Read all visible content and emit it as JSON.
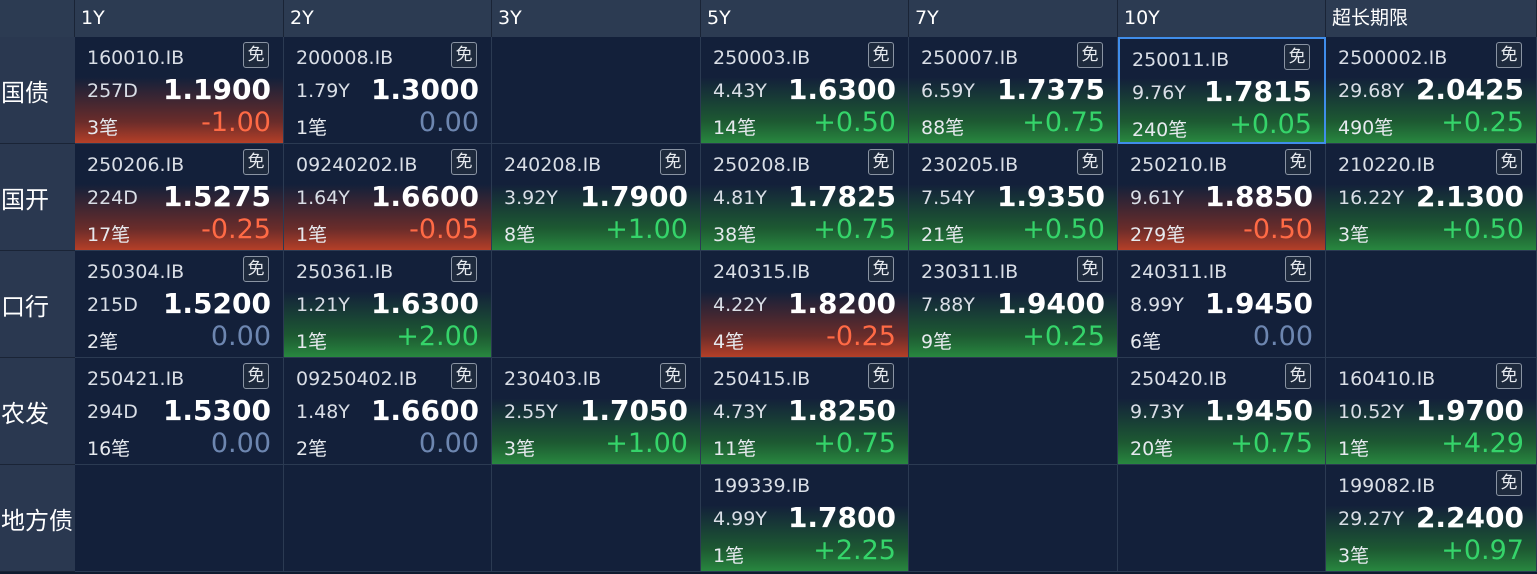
{
  "columns": [
    "1Y",
    "2Y",
    "3Y",
    "5Y",
    "7Y",
    "10Y",
    "超长期限"
  ],
  "rows": [
    {
      "label": "国债",
      "cells": [
        {
          "code": "160010.IB",
          "tenor": "257D",
          "yield": "1.1900",
          "trades": "3笔",
          "change": "-1.00",
          "dir": "down",
          "badge": "免"
        },
        {
          "code": "200008.IB",
          "tenor": "1.79Y",
          "yield": "1.3000",
          "trades": "1笔",
          "change": "0.00",
          "dir": "flat",
          "badge": "免"
        },
        null,
        {
          "code": "250003.IB",
          "tenor": "4.43Y",
          "yield": "1.6300",
          "trades": "14笔",
          "change": "+0.50",
          "dir": "up",
          "badge": "免"
        },
        {
          "code": "250007.IB",
          "tenor": "6.59Y",
          "yield": "1.7375",
          "trades": "88笔",
          "change": "+0.75",
          "dir": "up",
          "badge": "免"
        },
        {
          "code": "250011.IB",
          "tenor": "9.76Y",
          "yield": "1.7815",
          "trades": "240笔",
          "change": "+0.05",
          "dir": "up",
          "badge": "免",
          "selected": true
        },
        {
          "code": "2500002.IB",
          "tenor": "29.68Y",
          "yield": "2.0425",
          "trades": "490笔",
          "change": "+0.25",
          "dir": "up",
          "badge": "免"
        }
      ]
    },
    {
      "label": "国开",
      "cells": [
        {
          "code": "250206.IB",
          "tenor": "224D",
          "yield": "1.5275",
          "trades": "17笔",
          "change": "-0.25",
          "dir": "down",
          "badge": "免"
        },
        {
          "code": "09240202.IB",
          "tenor": "1.64Y",
          "yield": "1.6600",
          "trades": "1笔",
          "change": "-0.05",
          "dir": "down",
          "badge": "免"
        },
        {
          "code": "240208.IB",
          "tenor": "3.92Y",
          "yield": "1.7900",
          "trades": "8笔",
          "change": "+1.00",
          "dir": "up",
          "badge": "免"
        },
        {
          "code": "250208.IB",
          "tenor": "4.81Y",
          "yield": "1.7825",
          "trades": "38笔",
          "change": "+0.75",
          "dir": "up",
          "badge": "免"
        },
        {
          "code": "230205.IB",
          "tenor": "7.54Y",
          "yield": "1.9350",
          "trades": "21笔",
          "change": "+0.50",
          "dir": "up",
          "badge": "免"
        },
        {
          "code": "250210.IB",
          "tenor": "9.61Y",
          "yield": "1.8850",
          "trades": "279笔",
          "change": "-0.50",
          "dir": "down",
          "badge": "免"
        },
        {
          "code": "210220.IB",
          "tenor": "16.22Y",
          "yield": "2.1300",
          "trades": "3笔",
          "change": "+0.50",
          "dir": "up",
          "badge": "免"
        }
      ]
    },
    {
      "label": "口行",
      "cells": [
        {
          "code": "250304.IB",
          "tenor": "215D",
          "yield": "1.5200",
          "trades": "2笔",
          "change": "0.00",
          "dir": "flat",
          "badge": "免"
        },
        {
          "code": "250361.IB",
          "tenor": "1.21Y",
          "yield": "1.6300",
          "trades": "1笔",
          "change": "+2.00",
          "dir": "up",
          "badge": "免"
        },
        null,
        {
          "code": "240315.IB",
          "tenor": "4.22Y",
          "yield": "1.8200",
          "trades": "4笔",
          "change": "-0.25",
          "dir": "down",
          "badge": "免"
        },
        {
          "code": "230311.IB",
          "tenor": "7.88Y",
          "yield": "1.9400",
          "trades": "9笔",
          "change": "+0.25",
          "dir": "up",
          "badge": "免"
        },
        {
          "code": "240311.IB",
          "tenor": "8.99Y",
          "yield": "1.9450",
          "trades": "6笔",
          "change": "0.00",
          "dir": "flat",
          "badge": "免"
        },
        null
      ]
    },
    {
      "label": "农发",
      "cells": [
        {
          "code": "250421.IB",
          "tenor": "294D",
          "yield": "1.5300",
          "trades": "16笔",
          "change": "0.00",
          "dir": "flat",
          "badge": "免"
        },
        {
          "code": "09250402.IB",
          "tenor": "1.48Y",
          "yield": "1.6600",
          "trades": "2笔",
          "change": "0.00",
          "dir": "flat",
          "badge": "免"
        },
        {
          "code": "230403.IB",
          "tenor": "2.55Y",
          "yield": "1.7050",
          "trades": "3笔",
          "change": "+1.00",
          "dir": "up",
          "badge": "免"
        },
        {
          "code": "250415.IB",
          "tenor": "4.73Y",
          "yield": "1.8250",
          "trades": "11笔",
          "change": "+0.75",
          "dir": "up",
          "badge": "免"
        },
        null,
        {
          "code": "250420.IB",
          "tenor": "9.73Y",
          "yield": "1.9450",
          "trades": "20笔",
          "change": "+0.75",
          "dir": "up",
          "badge": "免"
        },
        {
          "code": "160410.IB",
          "tenor": "10.52Y",
          "yield": "1.9700",
          "trades": "1笔",
          "change": "+4.29",
          "dir": "up",
          "badge": "免"
        }
      ]
    },
    {
      "label": "地方债",
      "cells": [
        null,
        null,
        null,
        {
          "code": "199339.IB",
          "tenor": "4.99Y",
          "yield": "1.7800",
          "trades": "1笔",
          "change": "+2.25",
          "dir": "up",
          "badge": ""
        },
        null,
        null,
        {
          "code": "199082.IB",
          "tenor": "29.27Y",
          "yield": "2.2400",
          "trades": "3笔",
          "change": "+0.97",
          "dir": "up",
          "badge": "免"
        }
      ]
    }
  ]
}
